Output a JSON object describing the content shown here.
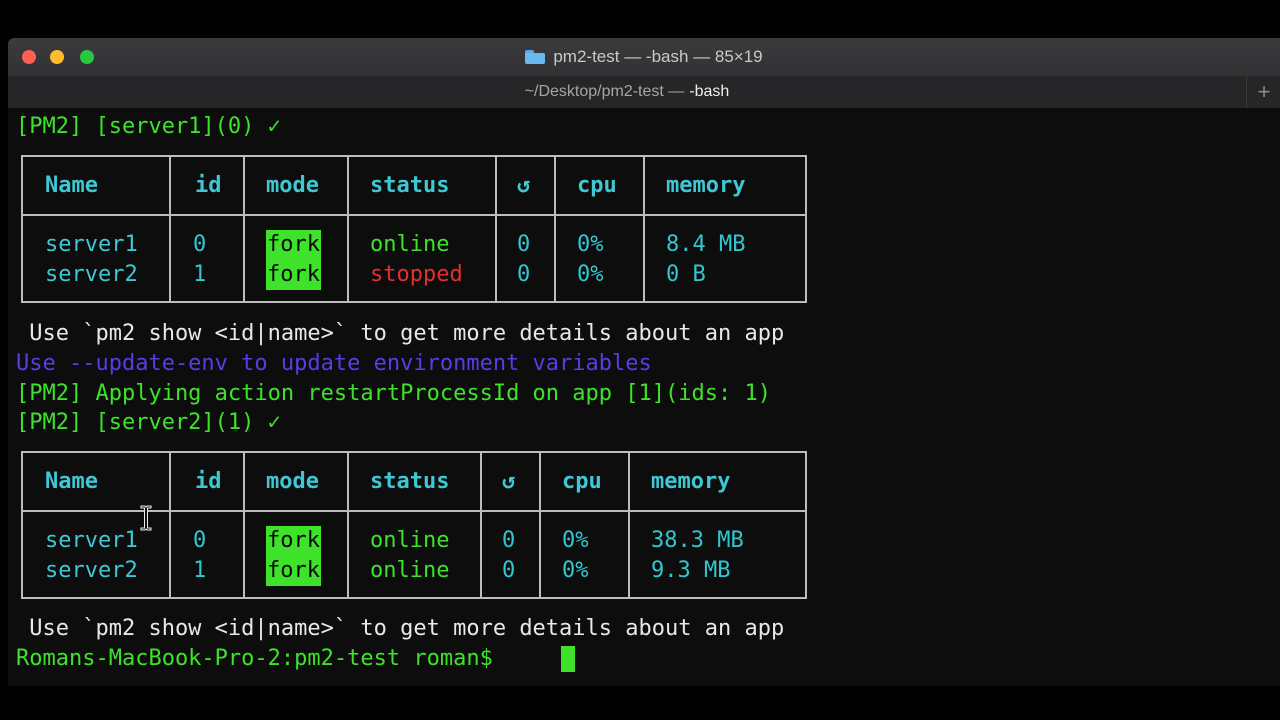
{
  "window": {
    "title": "pm2-test — -bash — 85×19",
    "tab_path": "~/Desktop/pm2-test —",
    "tab_cmd": "-bash",
    "new_tab_symbol": "+"
  },
  "colors": {
    "prompt_green": "#3ee22a",
    "header_cyan": "#3fc7d3",
    "stopped_red": "#e42f2f",
    "notice_purple": "#5d3ae8"
  },
  "lines": {
    "l1": "[PM2] [server1](0) ✓",
    "l2": " Use `pm2 show <id|name>` to get more details about an app",
    "l3": "Use --update-env to update environment variables",
    "l4": "[PM2] Applying action restartProcessId on app [1](ids: 1)",
    "l5": "[PM2] [server2](1) ✓",
    "l6": " Use `pm2 show <id|name>` to get more details about an app",
    "prompt": "Romans-MacBook-Pro-2:pm2-test roman$ "
  },
  "table_headers": [
    "Name",
    "id",
    "mode",
    "status",
    "↺",
    "cpu",
    "memory"
  ],
  "table1": {
    "rows": [
      {
        "name": "server1",
        "id": "0",
        "mode": "fork",
        "status": "online",
        "restarts": "0",
        "cpu": "0%",
        "memory": "8.4 MB"
      },
      {
        "name": "server2",
        "id": "1",
        "mode": "fork",
        "status": "stopped",
        "restarts": "0",
        "cpu": "0%",
        "memory": "0 B"
      }
    ]
  },
  "table2": {
    "rows": [
      {
        "name": "server1",
        "id": "0",
        "mode": "fork",
        "status": "online",
        "restarts": "0",
        "cpu": "0%",
        "memory": "38.3 MB"
      },
      {
        "name": "server2",
        "id": "1",
        "mode": "fork",
        "status": "online",
        "restarts": "0",
        "cpu": "0%",
        "memory": "9.3 MB"
      }
    ]
  }
}
